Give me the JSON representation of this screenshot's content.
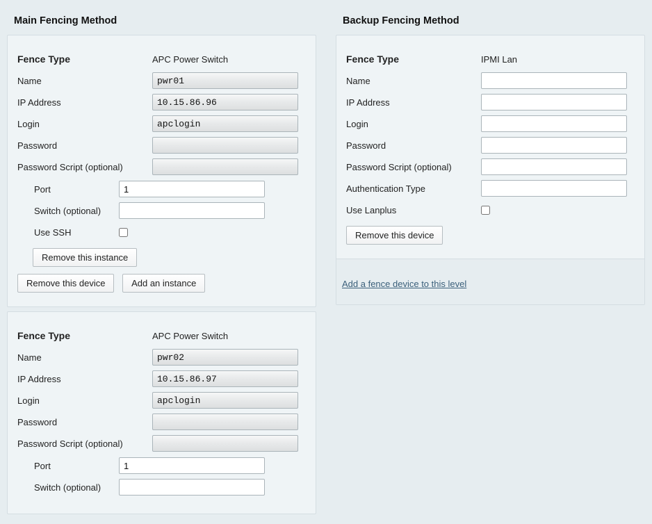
{
  "main": {
    "title": "Main Fencing Method",
    "devices": [
      {
        "fence_type_label": "Fence Type",
        "fence_type_value": "APC Power Switch",
        "name_label": "Name",
        "name_value": "pwr01",
        "ip_label": "IP Address",
        "ip_value": "10.15.86.96",
        "login_label": "Login",
        "login_value": "apclogin",
        "password_label": "Password",
        "password_value": "",
        "pwscript_label": "Password Script (optional)",
        "pwscript_value": "",
        "instance": {
          "port_label": "Port",
          "port_value": "1",
          "switch_label": "Switch (optional)",
          "switch_value": "",
          "ssh_label": "Use SSH",
          "remove_instance_label": "Remove this instance"
        },
        "remove_device_label": "Remove this device",
        "add_instance_label": "Add an instance"
      },
      {
        "fence_type_label": "Fence Type",
        "fence_type_value": "APC Power Switch",
        "name_label": "Name",
        "name_value": "pwr02",
        "ip_label": "IP Address",
        "ip_value": "10.15.86.97",
        "login_label": "Login",
        "login_value": "apclogin",
        "password_label": "Password",
        "password_value": "",
        "pwscript_label": "Password Script (optional)",
        "pwscript_value": "",
        "instance": {
          "port_label": "Port",
          "port_value": "1",
          "switch_label": "Switch (optional)",
          "switch_value": ""
        }
      }
    ]
  },
  "backup": {
    "title": "Backup Fencing Method",
    "device": {
      "fence_type_label": "Fence Type",
      "fence_type_value": "IPMI Lan",
      "name_label": "Name",
      "name_value": "",
      "ip_label": "IP Address",
      "ip_value": "",
      "login_label": "Login",
      "login_value": "",
      "password_label": "Password",
      "password_value": "",
      "pwscript_label": "Password Script (optional)",
      "pwscript_value": "",
      "auth_label": "Authentication Type",
      "auth_value": "",
      "lanplus_label": "Use Lanplus",
      "remove_device_label": "Remove this device"
    },
    "add_link": "Add a fence device to this level"
  }
}
